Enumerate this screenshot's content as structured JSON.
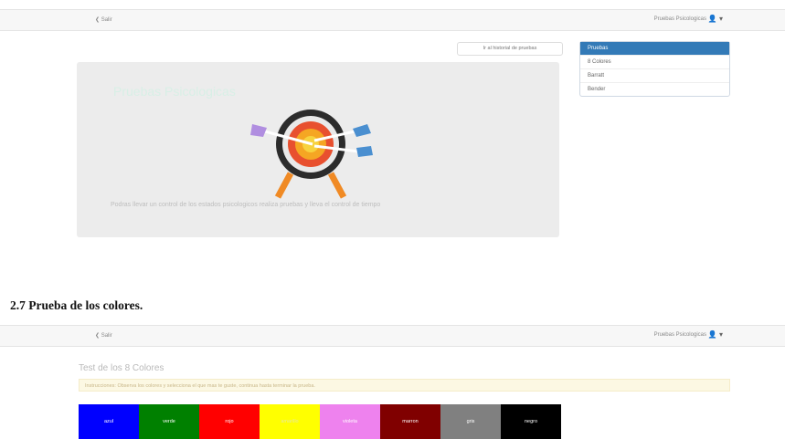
{
  "nav_back": "Salir",
  "nav_user": "Pruebas Psicologicas",
  "nav_user_icon": "user-icon",
  "history_button": "Ir al historial de pruebas",
  "tests_panel": {
    "title": "Pruebas",
    "items": [
      "8 Colores",
      "Barratt",
      "Bender"
    ]
  },
  "jumbotron": {
    "title": "Pruebas Psicologicas",
    "description": "Podras llevar un control de los estados psicologicos realiza pruebas y lleva el control de tiempo"
  },
  "section_heading": "2.7 Prueba de los colores.",
  "test_title": "Test de los 8 Colores",
  "instructions": "Instrucciones: Observa los colores y selecciona el que mas te guste, continua hasta terminar la prueba.",
  "colors": [
    {
      "label": "azul",
      "hex": "#0000ff"
    },
    {
      "label": "verde",
      "hex": "#008000"
    },
    {
      "label": "rojo",
      "hex": "#ff0000"
    },
    {
      "label": "amarillo",
      "hex": "#ffff00"
    },
    {
      "label": "violeta",
      "hex": "#ee82ee"
    },
    {
      "label": "marron",
      "hex": "#800000"
    },
    {
      "label": "gris",
      "hex": "#808080"
    },
    {
      "label": "negro",
      "hex": "#000000"
    }
  ]
}
